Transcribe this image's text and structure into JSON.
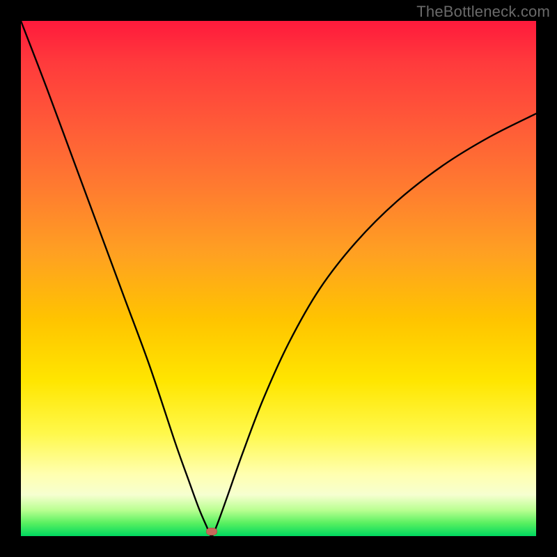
{
  "attribution": "TheBottleneck.com",
  "marker": {
    "x_frac": 0.37,
    "y_frac": 0.992
  },
  "chart_data": {
    "type": "line",
    "title": "",
    "xlabel": "",
    "ylabel": "",
    "xlim": [
      0,
      1
    ],
    "ylim": [
      0,
      1
    ],
    "series": [
      {
        "name": "curve",
        "x": [
          0.0,
          0.05,
          0.1,
          0.15,
          0.2,
          0.25,
          0.3,
          0.325,
          0.345,
          0.36,
          0.37,
          0.38,
          0.4,
          0.43,
          0.47,
          0.52,
          0.58,
          0.65,
          0.73,
          0.82,
          0.91,
          1.0
        ],
        "y": [
          1.0,
          0.87,
          0.735,
          0.6,
          0.465,
          0.33,
          0.18,
          0.11,
          0.055,
          0.02,
          0.0,
          0.02,
          0.075,
          0.16,
          0.265,
          0.375,
          0.48,
          0.57,
          0.65,
          0.72,
          0.775,
          0.82
        ]
      }
    ],
    "annotations": [
      {
        "name": "minimum-marker",
        "x": 0.37,
        "y": 0.008
      }
    ],
    "background_gradient": {
      "direction": "top-to-bottom",
      "stops": [
        {
          "pos": 0.0,
          "color": "#ff1a3c"
        },
        {
          "pos": 0.45,
          "color": "#ffa022"
        },
        {
          "pos": 0.7,
          "color": "#ffe600"
        },
        {
          "pos": 0.92,
          "color": "#f6ffd0"
        },
        {
          "pos": 1.0,
          "color": "#00d860"
        }
      ]
    }
  }
}
